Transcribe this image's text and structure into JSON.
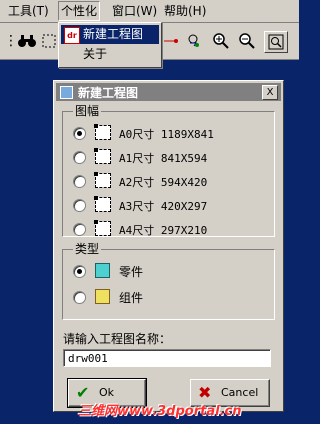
{
  "menubar": {
    "items": [
      {
        "label": "工具(T)"
      },
      {
        "label": "个性化"
      },
      {
        "label": "窗口(W)"
      },
      {
        "label": "帮助(H)"
      }
    ]
  },
  "dropdown": {
    "items": [
      {
        "label": "新建工程图",
        "icon": "drawing-icon"
      },
      {
        "label": "关于"
      }
    ]
  },
  "toolbar": {
    "icons": [
      "binoculars-icon",
      "select-rect-icon",
      "rotate-icon",
      "zoom-in-icon",
      "zoom-out-icon",
      "zoom-window-icon"
    ]
  },
  "dialog": {
    "title": "新建工程图",
    "close_label": "X",
    "sheet_group": {
      "label": "图幅",
      "options": [
        {
          "label": "A0尺寸 1189X841",
          "selected": true
        },
        {
          "label": "A1尺寸  841X594",
          "selected": false
        },
        {
          "label": "A2尺寸  594X420",
          "selected": false
        },
        {
          "label": "A3尺寸  420X297",
          "selected": false
        },
        {
          "label": "A4尺寸  297X210",
          "selected": false
        }
      ]
    },
    "type_group": {
      "label": "类型",
      "options": [
        {
          "label": "零件",
          "selected": true,
          "icon": "part-icon"
        },
        {
          "label": "组件",
          "selected": false,
          "icon": "assembly-icon"
        }
      ]
    },
    "name_prompt": "请输入工程图名称：",
    "name_value": "drw001",
    "ok_label": "Ok",
    "cancel_label": "Cancel"
  },
  "watermark": "三维网www.3dportal.cn",
  "colors": {
    "desktop": "#0a246a",
    "face": "#d4d0c8",
    "title_inactive": "#808080",
    "watermark": "#ff3030"
  }
}
